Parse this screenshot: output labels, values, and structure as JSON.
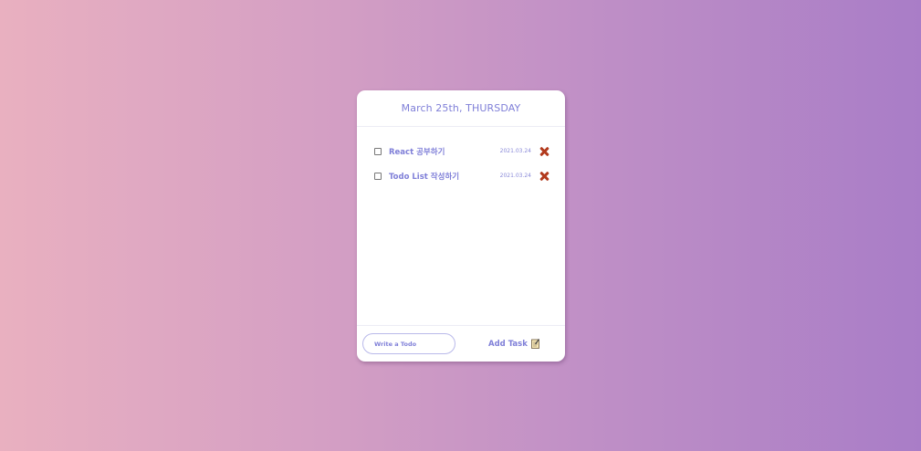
{
  "header": {
    "date_title": "March 25th, THURSDAY"
  },
  "todos": [
    {
      "text": "React 공부하기",
      "date": "2021.03.24",
      "checked": false
    },
    {
      "text": "Todo List 작성하기",
      "date": "2021.03.24",
      "checked": false
    }
  ],
  "footer": {
    "input_placeholder": "Write a Todo",
    "input_value": "",
    "add_label": "Add Task",
    "add_icon": "memo-icon"
  },
  "colors": {
    "accent": "#7f7fd8",
    "delete": "#b23a1d",
    "background_start": "#e9b0c0",
    "background_end": "#a97dc7"
  }
}
